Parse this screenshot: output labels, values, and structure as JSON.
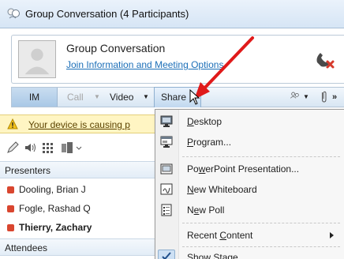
{
  "window": {
    "title": "Group Conversation (4 Participants)"
  },
  "header": {
    "conversation_title": "Group Conversation",
    "info_link": "Join Information and Meeting Options"
  },
  "toolbar": {
    "im_label": "IM",
    "call_label": "Call",
    "video_label": "Video",
    "share_label": "Share",
    "more_label": "»"
  },
  "warning": {
    "text": "Your device is causing p"
  },
  "participants": {
    "presenters_header": "Presenters",
    "presenters": [
      {
        "name": "Dooling, Brian J",
        "status_color": "#d9462f"
      },
      {
        "name": "Fogle, Rashad Q",
        "status_color": "#d9462f"
      },
      {
        "name": "Thierry, Zachary",
        "status_color": "#d9462f"
      }
    ],
    "attendees_header": "Attendees"
  },
  "share_menu": {
    "items": [
      {
        "label_prefix": "",
        "accel": "D",
        "label_rest": "esktop",
        "icon": "monitor-icon"
      },
      {
        "label_prefix": "",
        "accel": "P",
        "label_rest": "rogram...",
        "icon": "program-window-icon"
      },
      {
        "label_prefix": "Po",
        "accel": "w",
        "label_rest": "erPoint Presentation...",
        "icon": "powerpoint-icon"
      },
      {
        "label_prefix": "",
        "accel": "N",
        "label_rest": "ew Whiteboard",
        "icon": "whiteboard-icon"
      },
      {
        "label_prefix": "N",
        "accel": "e",
        "label_rest": "w Poll",
        "icon": "poll-icon"
      },
      {
        "label_prefix": "Recent ",
        "accel": "C",
        "label_rest": "ontent",
        "icon": ""
      },
      {
        "label_prefix": "Show Stage",
        "accel": "",
        "label_rest": "",
        "icon": "checkmark-icon"
      }
    ]
  },
  "colors": {
    "annotation_arrow": "#e01a1a",
    "presence_busy": "#d9462f",
    "hangup_red": "#d63a2c"
  }
}
